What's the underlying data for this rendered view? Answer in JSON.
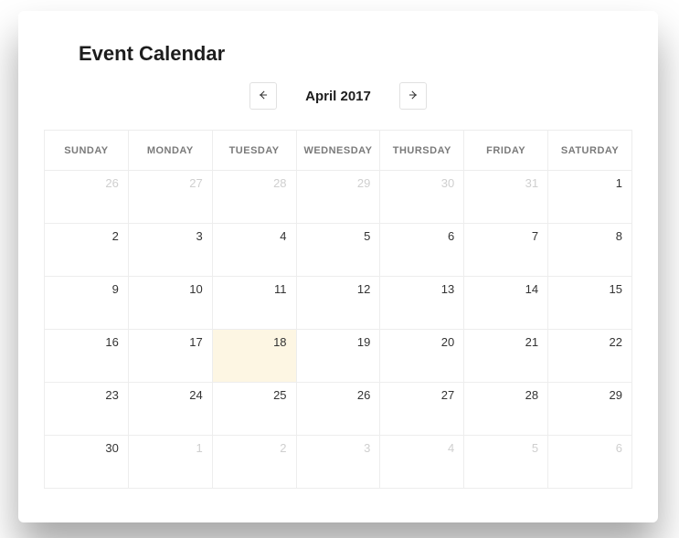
{
  "title": "Event Calendar",
  "month_label": "April 2017",
  "day_headers": [
    "SUNDAY",
    "MONDAY",
    "TUESDAY",
    "WEDNESDAY",
    "THURSDAY",
    "FRIDAY",
    "SATURDAY"
  ],
  "weeks": [
    [
      {
        "n": 26,
        "other": true
      },
      {
        "n": 27,
        "other": true
      },
      {
        "n": 28,
        "other": true
      },
      {
        "n": 29,
        "other": true
      },
      {
        "n": 30,
        "other": true
      },
      {
        "n": 31,
        "other": true
      },
      {
        "n": 1
      }
    ],
    [
      {
        "n": 2
      },
      {
        "n": 3
      },
      {
        "n": 4
      },
      {
        "n": 5
      },
      {
        "n": 6
      },
      {
        "n": 7
      },
      {
        "n": 8
      }
    ],
    [
      {
        "n": 9
      },
      {
        "n": 10
      },
      {
        "n": 11
      },
      {
        "n": 12
      },
      {
        "n": 13
      },
      {
        "n": 14
      },
      {
        "n": 15
      }
    ],
    [
      {
        "n": 16
      },
      {
        "n": 17
      },
      {
        "n": 18,
        "today": true
      },
      {
        "n": 19
      },
      {
        "n": 20
      },
      {
        "n": 21
      },
      {
        "n": 22
      }
    ],
    [
      {
        "n": 23
      },
      {
        "n": 24
      },
      {
        "n": 25
      },
      {
        "n": 26
      },
      {
        "n": 27
      },
      {
        "n": 28
      },
      {
        "n": 29
      }
    ],
    [
      {
        "n": 30
      },
      {
        "n": 1,
        "other": true
      },
      {
        "n": 2,
        "other": true
      },
      {
        "n": 3,
        "other": true
      },
      {
        "n": 4,
        "other": true
      },
      {
        "n": 5,
        "other": true
      },
      {
        "n": 6,
        "other": true
      }
    ]
  ]
}
